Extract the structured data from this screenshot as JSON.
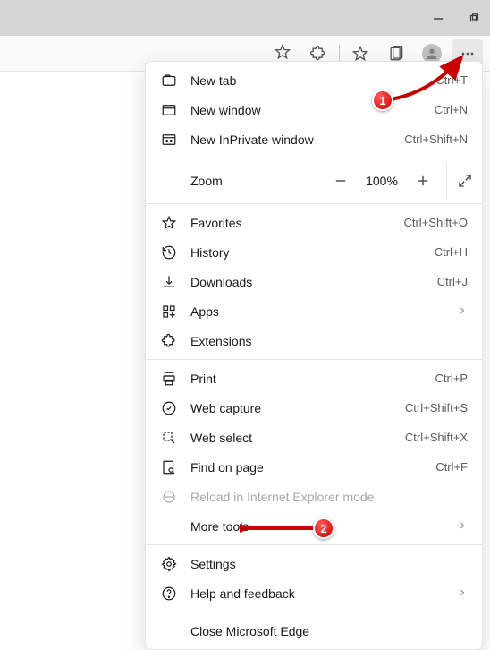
{
  "annotations": {
    "badge1": "1",
    "badge2": "2"
  },
  "menu": {
    "newTab": {
      "label": "New tab",
      "shortcut": "Ctrl+T"
    },
    "newWindow": {
      "label": "New window",
      "shortcut": "Ctrl+N"
    },
    "newInPrivate": {
      "label": "New InPrivate window",
      "shortcut": "Ctrl+Shift+N"
    },
    "zoom": {
      "label": "Zoom",
      "value": "100%"
    },
    "favorites": {
      "label": "Favorites",
      "shortcut": "Ctrl+Shift+O"
    },
    "history": {
      "label": "History",
      "shortcut": "Ctrl+H"
    },
    "downloads": {
      "label": "Downloads",
      "shortcut": "Ctrl+J"
    },
    "apps": {
      "label": "Apps"
    },
    "extensions": {
      "label": "Extensions"
    },
    "print": {
      "label": "Print",
      "shortcut": "Ctrl+P"
    },
    "webCapture": {
      "label": "Web capture",
      "shortcut": "Ctrl+Shift+S"
    },
    "webSelect": {
      "label": "Web select",
      "shortcut": "Ctrl+Shift+X"
    },
    "findOnPage": {
      "label": "Find on page",
      "shortcut": "Ctrl+F"
    },
    "reloadIE": {
      "label": "Reload in Internet Explorer mode"
    },
    "moreTools": {
      "label": "More tools"
    },
    "settings": {
      "label": "Settings"
    },
    "help": {
      "label": "Help and feedback"
    },
    "close": {
      "label": "Close Microsoft Edge"
    }
  }
}
